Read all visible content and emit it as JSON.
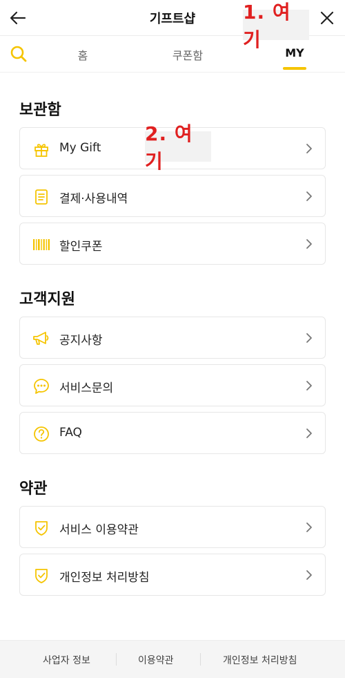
{
  "header": {
    "title": "기프트샵",
    "back_icon": "back-arrow-icon",
    "close_icon": "close-icon"
  },
  "annotations": {
    "first": "1. 여기",
    "second": "2. 여기",
    "color": "#e02020"
  },
  "tabs": {
    "search_icon": "search-icon",
    "items": [
      {
        "label": "홈",
        "selected": false
      },
      {
        "label": "쿠폰함",
        "selected": false
      },
      {
        "label": "MY",
        "selected": true
      }
    ],
    "accent": "#f5c400"
  },
  "sections": [
    {
      "title": "보관함",
      "items": [
        {
          "label": "My Gift",
          "icon": "gift-icon"
        },
        {
          "label": "결제·사용내역",
          "icon": "receipt-icon"
        },
        {
          "label": "할인쿠폰",
          "icon": "barcode-icon"
        }
      ]
    },
    {
      "title": "고객지원",
      "items": [
        {
          "label": "공지사항",
          "icon": "megaphone-icon"
        },
        {
          "label": "서비스문의",
          "icon": "chat-icon"
        },
        {
          "label": "FAQ",
          "icon": "question-icon"
        }
      ]
    },
    {
      "title": "약관",
      "items": [
        {
          "label": "서비스 이용약관",
          "icon": "shield-check-icon"
        },
        {
          "label": "개인정보 처리방침",
          "icon": "shield-check-icon"
        }
      ]
    }
  ],
  "footer": {
    "links": [
      "사업자 정보",
      "이용약관",
      "개인정보 처리방침"
    ]
  },
  "colors": {
    "accent": "#f5c400",
    "card_border": "#e6e6e6",
    "footer_bg": "#f5f5f5"
  }
}
